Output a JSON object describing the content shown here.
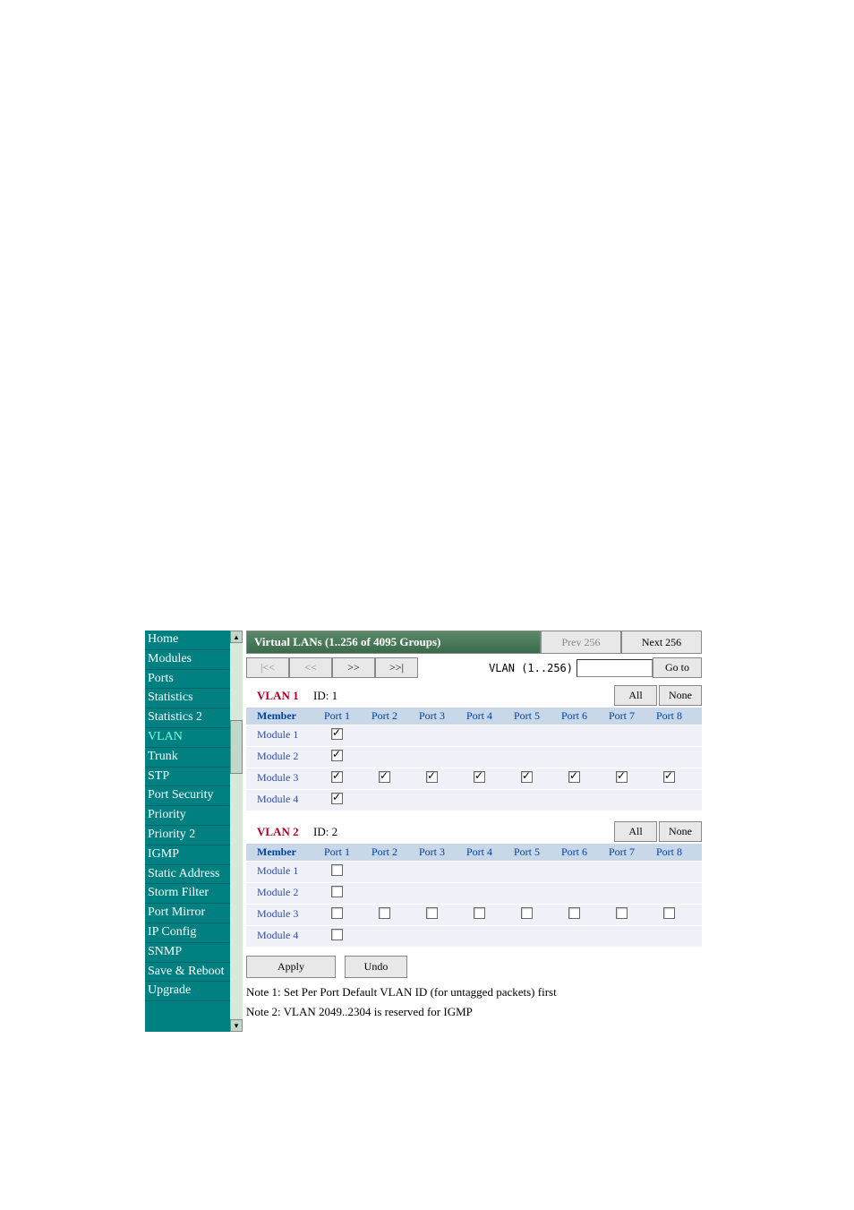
{
  "sidebar": {
    "items": [
      {
        "label": "Home",
        "active": false
      },
      {
        "label": "Modules",
        "active": false
      },
      {
        "label": "Ports",
        "active": false
      },
      {
        "label": "Statistics",
        "active": false
      },
      {
        "label": "Statistics 2",
        "active": false
      },
      {
        "label": "VLAN",
        "active": true
      },
      {
        "label": "Trunk",
        "active": false
      },
      {
        "label": "STP",
        "active": false
      },
      {
        "label": "Port Security",
        "active": false
      },
      {
        "label": "Priority",
        "active": false
      },
      {
        "label": "Priority 2",
        "active": false
      },
      {
        "label": "IGMP",
        "active": false
      },
      {
        "label": "Static Address",
        "active": false
      },
      {
        "label": "Storm Filter",
        "active": false
      },
      {
        "label": "Port Mirror",
        "active": false
      },
      {
        "label": "IP Config",
        "active": false
      },
      {
        "label": "SNMP",
        "active": false
      },
      {
        "label": "Save & Reboot",
        "active": false
      },
      {
        "label": "Upgrade",
        "active": false
      }
    ]
  },
  "header": {
    "title": "Virtual LANs (1..256 of 4095 Groups)",
    "prev": "Prev 256",
    "next": "Next 256"
  },
  "nav": {
    "first": "|<<",
    "prev": "<<",
    "next": ">>",
    "last": ">>|",
    "range_label": "VLAN (1..256)",
    "range_value": "",
    "goto": "Go to"
  },
  "ports": [
    "Port 1",
    "Port 2",
    "Port 3",
    "Port 4",
    "Port 5",
    "Port 6",
    "Port 7",
    "Port 8"
  ],
  "member_label": "Member",
  "all_label": "All",
  "none_label": "None",
  "vlans": [
    {
      "name": "VLAN 1",
      "id_label": "ID: 1",
      "modules": [
        {
          "label": "Module 1",
          "ports": [
            true,
            null,
            null,
            null,
            null,
            null,
            null,
            null
          ]
        },
        {
          "label": "Module 2",
          "ports": [
            true,
            null,
            null,
            null,
            null,
            null,
            null,
            null
          ]
        },
        {
          "label": "Module 3",
          "ports": [
            true,
            true,
            true,
            true,
            true,
            true,
            true,
            true
          ]
        },
        {
          "label": "Module 4",
          "ports": [
            true,
            null,
            null,
            null,
            null,
            null,
            null,
            null
          ]
        }
      ]
    },
    {
      "name": "VLAN 2",
      "id_label": "ID: 2",
      "modules": [
        {
          "label": "Module 1",
          "ports": [
            false,
            null,
            null,
            null,
            null,
            null,
            null,
            null
          ]
        },
        {
          "label": "Module 2",
          "ports": [
            false,
            null,
            null,
            null,
            null,
            null,
            null,
            null
          ]
        },
        {
          "label": "Module 3",
          "ports": [
            false,
            false,
            false,
            false,
            false,
            false,
            false,
            false
          ]
        },
        {
          "label": "Module 4",
          "ports": [
            false,
            null,
            null,
            null,
            null,
            null,
            null,
            null
          ]
        }
      ]
    }
  ],
  "actions": {
    "apply": "Apply",
    "undo": "Undo"
  },
  "notes": [
    "Note 1: Set Per Port Default VLAN ID (for untagged packets) first",
    "Note 2: VLAN 2049..2304 is reserved for IGMP"
  ]
}
